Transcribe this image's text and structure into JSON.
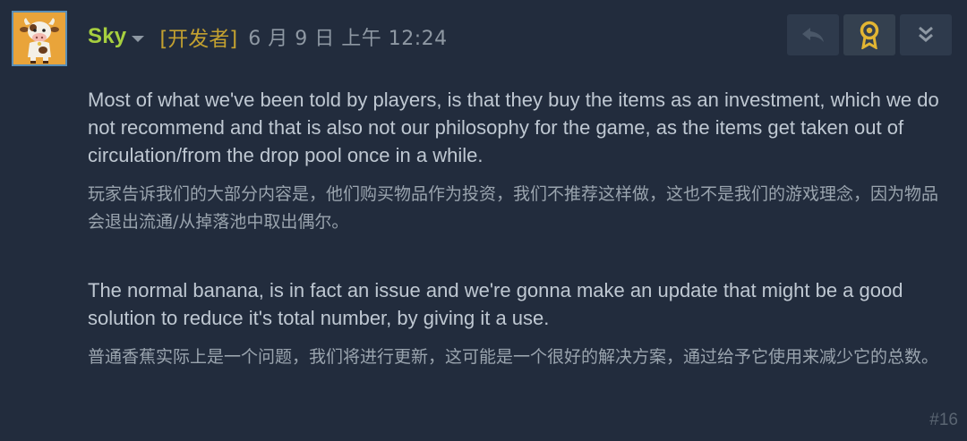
{
  "post": {
    "author": "Sky",
    "developer_tag": "[开发者]",
    "timestamp": "6 月 9 日 上午 12:24",
    "post_number": "#16",
    "actions": [
      {
        "name": "reply-icon"
      },
      {
        "name": "award-icon"
      },
      {
        "name": "expand-down-icon"
      }
    ],
    "paragraphs": [
      {
        "en": "Most of what we've been told by players, is that they buy the items as an investment, which we do not recommend and that is also not our philosophy for the game, as the items get taken out of circulation/from the drop pool once in a while.",
        "zh": "玩家告诉我们的大部分内容是，他们购买物品作为投资，我们不推荐这样做，这也不是我们的游戏理念，因为物品会退出流通/从掉落池中取出偶尔。"
      },
      {
        "en": "The normal banana, is in fact an issue and we're gonna make an update that might be a good solution to reduce it's total number, by giving it a use.",
        "zh": "普通香蕉实际上是一个问题，我们将进行更新，这可能是一个很好的解决方案，通过给予它使用来减少它的总数。"
      }
    ]
  },
  "colors": {
    "background": "#222c3d",
    "author": "#a7cf3f",
    "developer_tag": "#c2a030",
    "award": "#e2b533"
  }
}
